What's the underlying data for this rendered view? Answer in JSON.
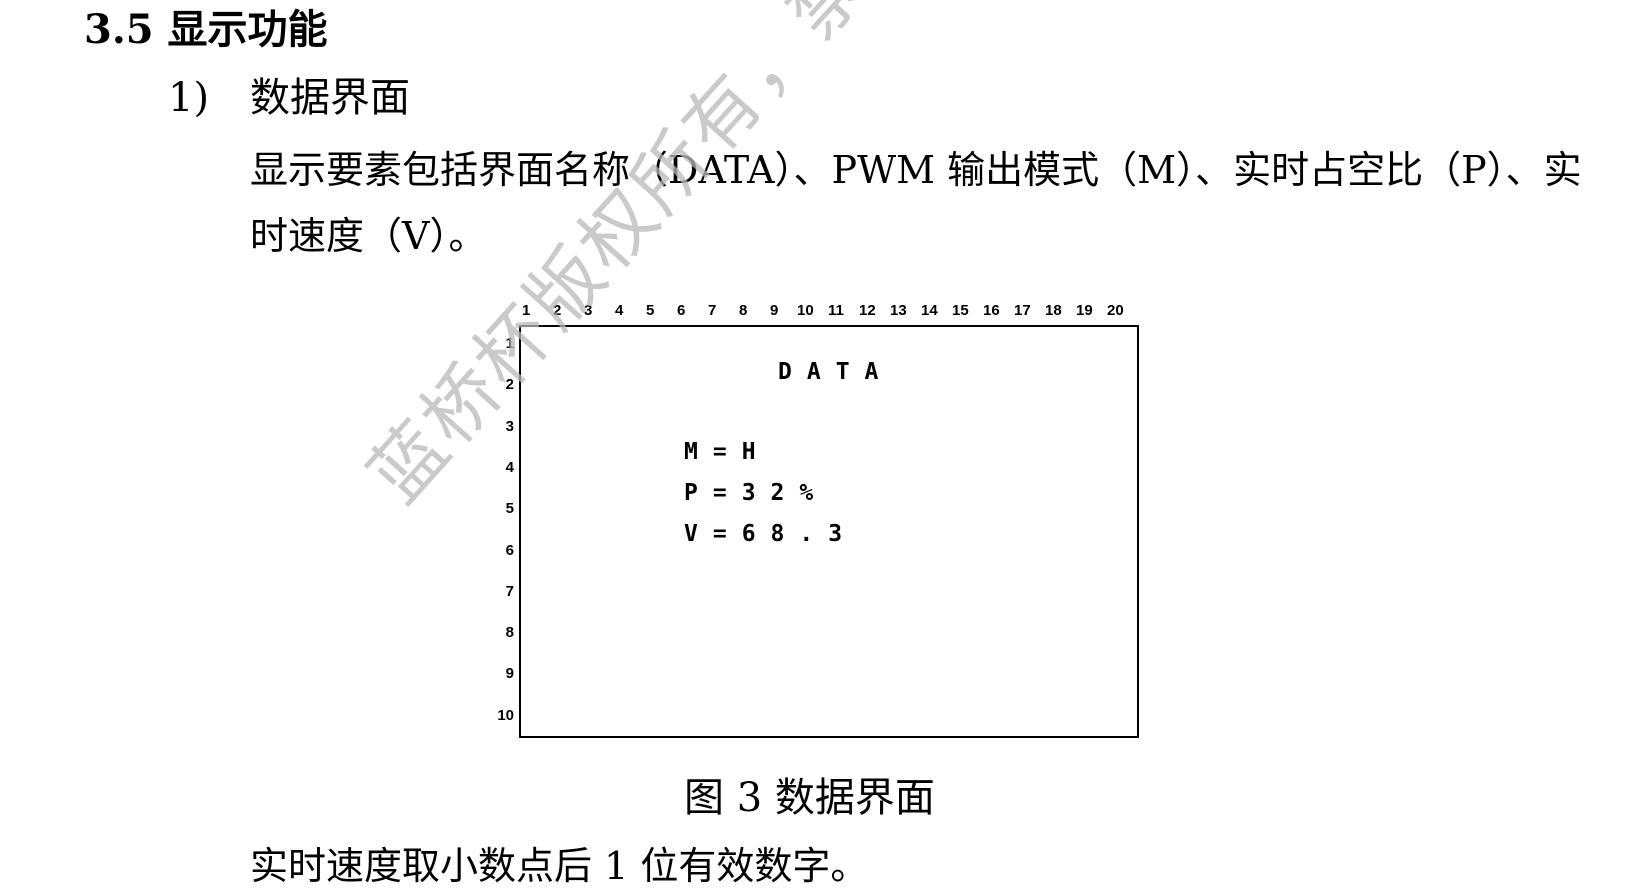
{
  "section": {
    "title": "3.5 显示功能"
  },
  "item": {
    "number": "1)",
    "title": "数据界面"
  },
  "paragraphs": {
    "line1": "显示要素包括界面名称（DATA）、PWM 输出模式（M）、实时占空比（P）、实",
    "line2": "时速度（V）。",
    "after": "实时速度取小数点后 1 位有效数字。"
  },
  "figure": {
    "caption": "图 3  数据界面",
    "column_numbers": [
      "1",
      "2",
      "3",
      "4",
      "5",
      "6",
      "7",
      "8",
      "9",
      "10",
      "11",
      "12",
      "13",
      "14",
      "15",
      "16",
      "17",
      "18",
      "19",
      "20"
    ],
    "row_numbers": [
      "1",
      "2",
      "3",
      "4",
      "5",
      "6",
      "7",
      "8",
      "9",
      "10"
    ],
    "lcd": {
      "title": "DATA",
      "mode": "M=H",
      "duty": "P=32%",
      "speed": "V=68.3"
    }
  },
  "watermark": "蓝桥杯版权所有，禁止商"
}
